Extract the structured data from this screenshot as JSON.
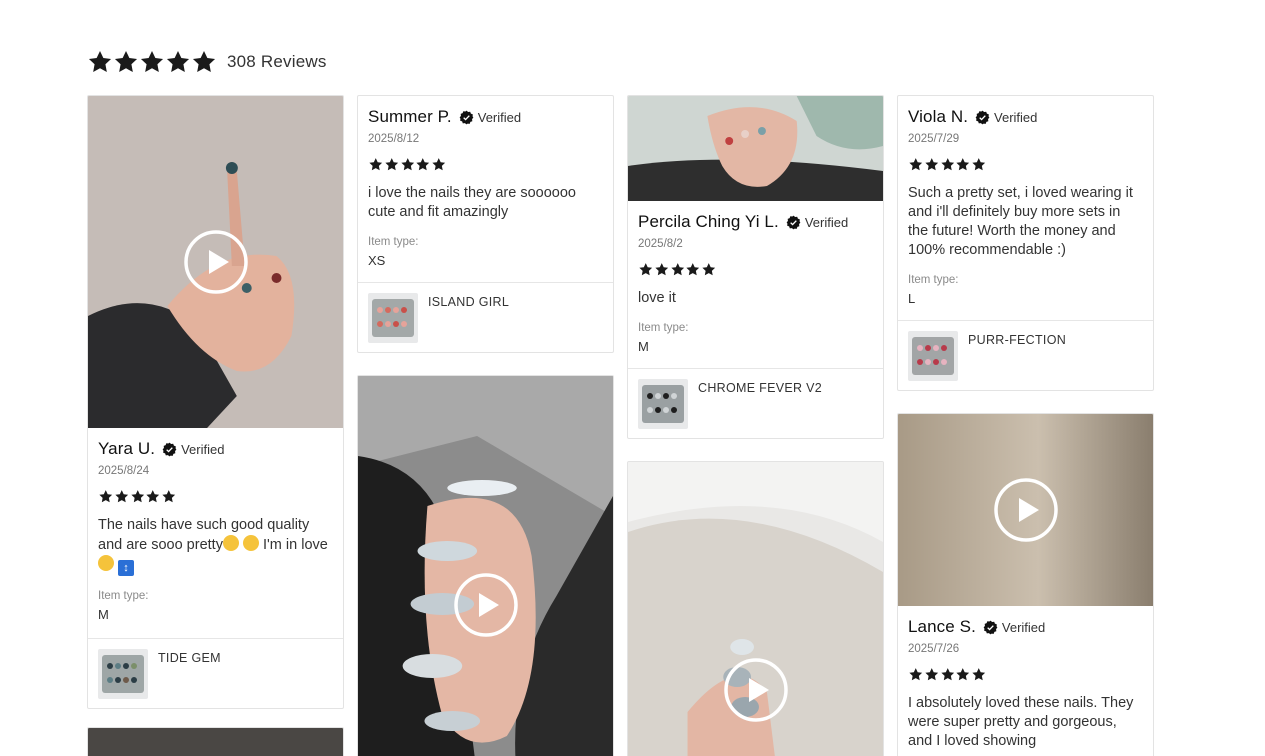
{
  "summary": {
    "rating": 5,
    "count_text": "308 Reviews"
  },
  "verified_label": "Verified",
  "item_type_label": "Item type:",
  "colors": {
    "star": "#1a1a1a",
    "badge": "#111111",
    "border": "#e3e3e3"
  },
  "reviews": [
    {
      "name": "Yara U.",
      "date": "2025/8/24",
      "rating": 5,
      "text": "The nails have such good quality and are sooo pretty",
      "text_tail": " I'm in love",
      "item_type": "M",
      "product": "TIDE GEM",
      "has_video": true
    },
    {
      "name": "Summer P.",
      "date": "2025/8/12",
      "rating": 5,
      "text": "i love the nails they are soooooo cute and fit amazingly",
      "item_type": "XS",
      "product": "ISLAND GIRL",
      "has_video": false
    },
    {
      "name": "Percila Ching Yi L.",
      "date": "2025/8/2",
      "rating": 5,
      "text": "love it",
      "item_type": "M",
      "product": "CHROME FEVER V2",
      "has_video": false
    },
    {
      "name": "Viola N.",
      "date": "2025/7/29",
      "rating": 5,
      "text": "Such a pretty set, i loved wearing it and i'll definitely buy more sets in the future! Worth the money and 100% recommendable :)",
      "item_type": "L",
      "product": "PURR-FECTION",
      "has_video": false
    },
    {
      "name": "Lance S.",
      "date": "2025/7/26",
      "rating": 5,
      "text": "I absolutely loved these nails. They were super pretty and gorgeous, and I loved showing",
      "has_video": true
    }
  ],
  "icons": {
    "star": "star-icon",
    "verified": "verified-badge-icon",
    "play": "play-icon"
  }
}
